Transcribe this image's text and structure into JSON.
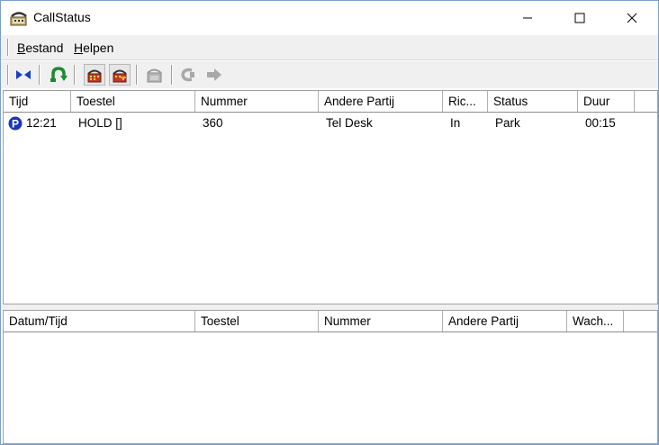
{
  "window": {
    "title": "CallStatus"
  },
  "menu": {
    "items": [
      {
        "label": "Bestand",
        "accel": "B",
        "rest": "estand"
      },
      {
        "label": "Helpen",
        "accel": "H",
        "rest": "elpen"
      }
    ]
  },
  "toolbar": {
    "buttons": [
      "cross-arrows-icon",
      "pickup-icon",
      "park-icon",
      "unpark-icon",
      "transfer-icon",
      "redial-icon",
      "forward-icon"
    ]
  },
  "calls": {
    "columns": [
      "Tijd",
      "Toestel",
      "Nummer",
      "Andere Partij",
      "Ric...",
      "Status",
      "Duur"
    ],
    "rows": [
      {
        "status_icon": "P",
        "tijd": "12:21",
        "toestel": "HOLD []",
        "nummer": "360",
        "andere_partij": "Tel Desk",
        "richting": "In",
        "status": "Park",
        "duur": "00:15"
      }
    ]
  },
  "history": {
    "columns": [
      "Datum/Tijd",
      "Toestel",
      "Nummer",
      "Andere Partij",
      "Wach..."
    ],
    "rows": []
  },
  "colors": {
    "accent": "#1a3fbf",
    "park_badge": "#1d36b8"
  }
}
